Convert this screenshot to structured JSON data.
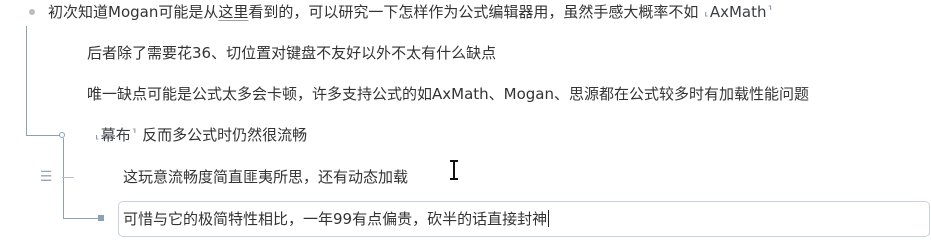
{
  "rows": {
    "r1": {
      "before": "初次知道Mogan可能是从",
      "link": "这里",
      "after": "看到的，可以研究一下怎样作为公式编辑器用，虽然手感大概率不如 ",
      "ref_label": "AxMath"
    },
    "r2": {
      "text": "后者除了需要花36、切位置对键盘不友好以外不太有什么缺点"
    },
    "r3": {
      "text": "唯一缺点可能是公式太多会卡顿，许多支持公式的如AxMath、Mogan、思源都在公式较多时有加载性能问题"
    },
    "r4": {
      "ref_label": "幕布",
      "after": " 反而多公式时仍然很流畅"
    },
    "r5": {
      "text": "这玩意流畅度简直匪夷所思，还有动态加载"
    },
    "r6": {
      "text": "可惜与它的极简特性相比，一年99有点偏贵，砍半的话直接封神"
    }
  },
  "icons": {
    "bullet": "bullet-dot",
    "drag": "drag-handle-icon",
    "ref_open": "block-ref-open-icon",
    "ref_close": "block-ref-close-icon",
    "cursor": "text-cursor-icon"
  },
  "colors": {
    "connector": "#8aa1b8",
    "text": "#333333",
    "bullet": "#b9bdc3"
  }
}
